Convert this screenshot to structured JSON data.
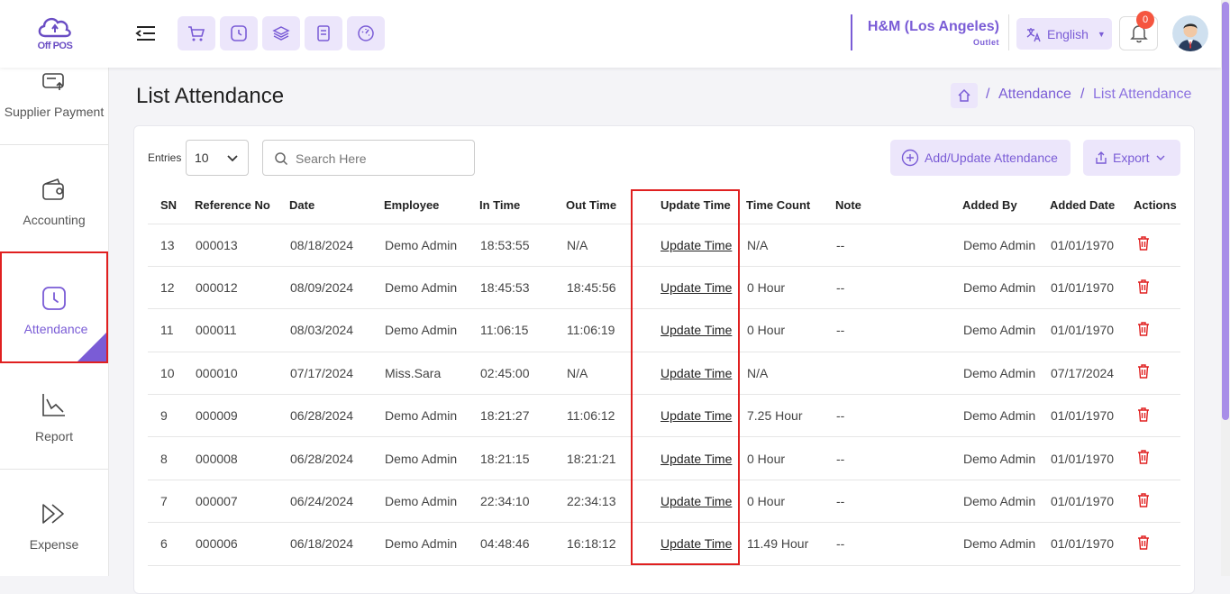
{
  "app": {
    "logo_text": "Off POS"
  },
  "header": {
    "outlet_name": "H&M (Los Angeles)",
    "outlet_type": "Outlet",
    "language": "English",
    "notification_count": "0"
  },
  "sidebar": {
    "items": [
      {
        "label": "Supplier Payment"
      },
      {
        "label": "Accounting"
      },
      {
        "label": "Attendance"
      },
      {
        "label": "Report"
      },
      {
        "label": "Expense"
      }
    ]
  },
  "page": {
    "title": "List Attendance",
    "breadcrumb": {
      "link": "Attendance",
      "current": "List Attendance",
      "separator": "/"
    }
  },
  "controls": {
    "entries_label": "Entries",
    "entries_value": "10",
    "search_placeholder": "Search Here",
    "add_button": "Add/Update Attendance",
    "export_button": "Export"
  },
  "table": {
    "headers": [
      "SN",
      "Reference No",
      "Date",
      "Employee",
      "In Time",
      "Out Time",
      "Update Time",
      "Time Count",
      "Note",
      "Added By",
      "Added Date",
      "Actions"
    ],
    "rows": [
      {
        "sn": "13",
        "ref": "000013",
        "date": "08/18/2024",
        "employee": "Demo Admin",
        "in": "18:53:55",
        "out": "N/A",
        "update": "Update Time",
        "count": "N/A",
        "note": "--",
        "added_by": "Demo Admin",
        "added_date": "01/01/1970"
      },
      {
        "sn": "12",
        "ref": "000012",
        "date": "08/09/2024",
        "employee": "Demo Admin",
        "in": "18:45:53",
        "out": "18:45:56",
        "update": "Update Time",
        "count": "0 Hour",
        "note": "--",
        "added_by": "Demo Admin",
        "added_date": "01/01/1970"
      },
      {
        "sn": "11",
        "ref": "000011",
        "date": "08/03/2024",
        "employee": "Demo Admin",
        "in": "11:06:15",
        "out": "11:06:19",
        "update": "Update Time",
        "count": "0 Hour",
        "note": "--",
        "added_by": "Demo Admin",
        "added_date": "01/01/1970"
      },
      {
        "sn": "10",
        "ref": "000010",
        "date": "07/17/2024",
        "employee": "Miss.Sara",
        "in": "02:45:00",
        "out": "N/A",
        "update": "Update Time",
        "count": "N/A",
        "note": "",
        "added_by": "Demo Admin",
        "added_date": "07/17/2024"
      },
      {
        "sn": "9",
        "ref": "000009",
        "date": "06/28/2024",
        "employee": "Demo Admin",
        "in": "18:21:27",
        "out": "11:06:12",
        "update": "Update Time",
        "count": "7.25 Hour",
        "note": "--",
        "added_by": "Demo Admin",
        "added_date": "01/01/1970"
      },
      {
        "sn": "8",
        "ref": "000008",
        "date": "06/28/2024",
        "employee": "Demo Admin",
        "in": "18:21:15",
        "out": "18:21:21",
        "update": "Update Time",
        "count": "0 Hour",
        "note": "--",
        "added_by": "Demo Admin",
        "added_date": "01/01/1970"
      },
      {
        "sn": "7",
        "ref": "000007",
        "date": "06/24/2024",
        "employee": "Demo Admin",
        "in": "22:34:10",
        "out": "22:34:13",
        "update": "Update Time",
        "count": "0 Hour",
        "note": "--",
        "added_by": "Demo Admin",
        "added_date": "01/01/1970"
      },
      {
        "sn": "6",
        "ref": "000006",
        "date": "06/18/2024",
        "employee": "Demo Admin",
        "in": "04:48:46",
        "out": "16:18:12",
        "update": "Update Time",
        "count": "11.49 Hour",
        "note": "--",
        "added_by": "Demo Admin",
        "added_date": "01/01/1970"
      }
    ]
  },
  "colors": {
    "accent": "#7a5cd6",
    "accent_bg": "#ece6fb",
    "danger": "#e02020",
    "badge": "#f5553f"
  },
  "icons": [
    "logo-cloud-icon",
    "menu-toggle-icon",
    "cart-icon",
    "clock-icon",
    "layers-icon",
    "receipt-icon",
    "dashboard-icon",
    "translate-icon",
    "bell-icon",
    "home-icon",
    "search-icon",
    "plus-circle-icon",
    "export-icon",
    "trash-icon"
  ]
}
